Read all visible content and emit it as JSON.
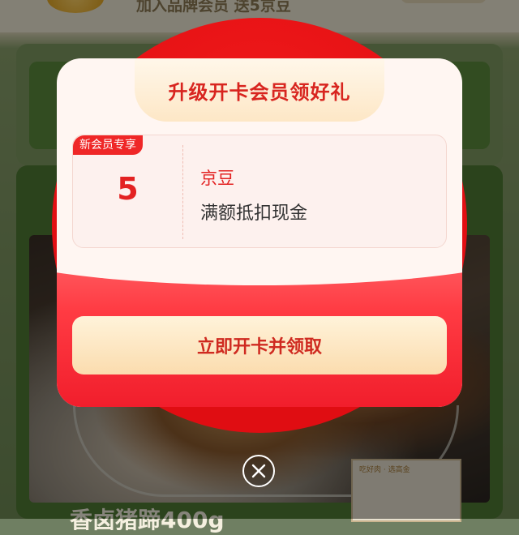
{
  "background": {
    "join_text": "加入品牌会员 送5京豆",
    "product_title": "香卤猪蹄400g",
    "pack_label": "吃好肉 · 选高金"
  },
  "modal": {
    "title": "升级开卡会员领好礼",
    "coupon": {
      "badge": "新会员专享",
      "amount": "5",
      "name": "京豆",
      "description": "满额抵扣现金"
    },
    "cta_label": "立即开卡并领取",
    "close_icon": "close-icon"
  },
  "colors": {
    "accent_red": "#e32222",
    "modal_red": "#f11e2c",
    "cta_gold": "#fbdcae"
  }
}
